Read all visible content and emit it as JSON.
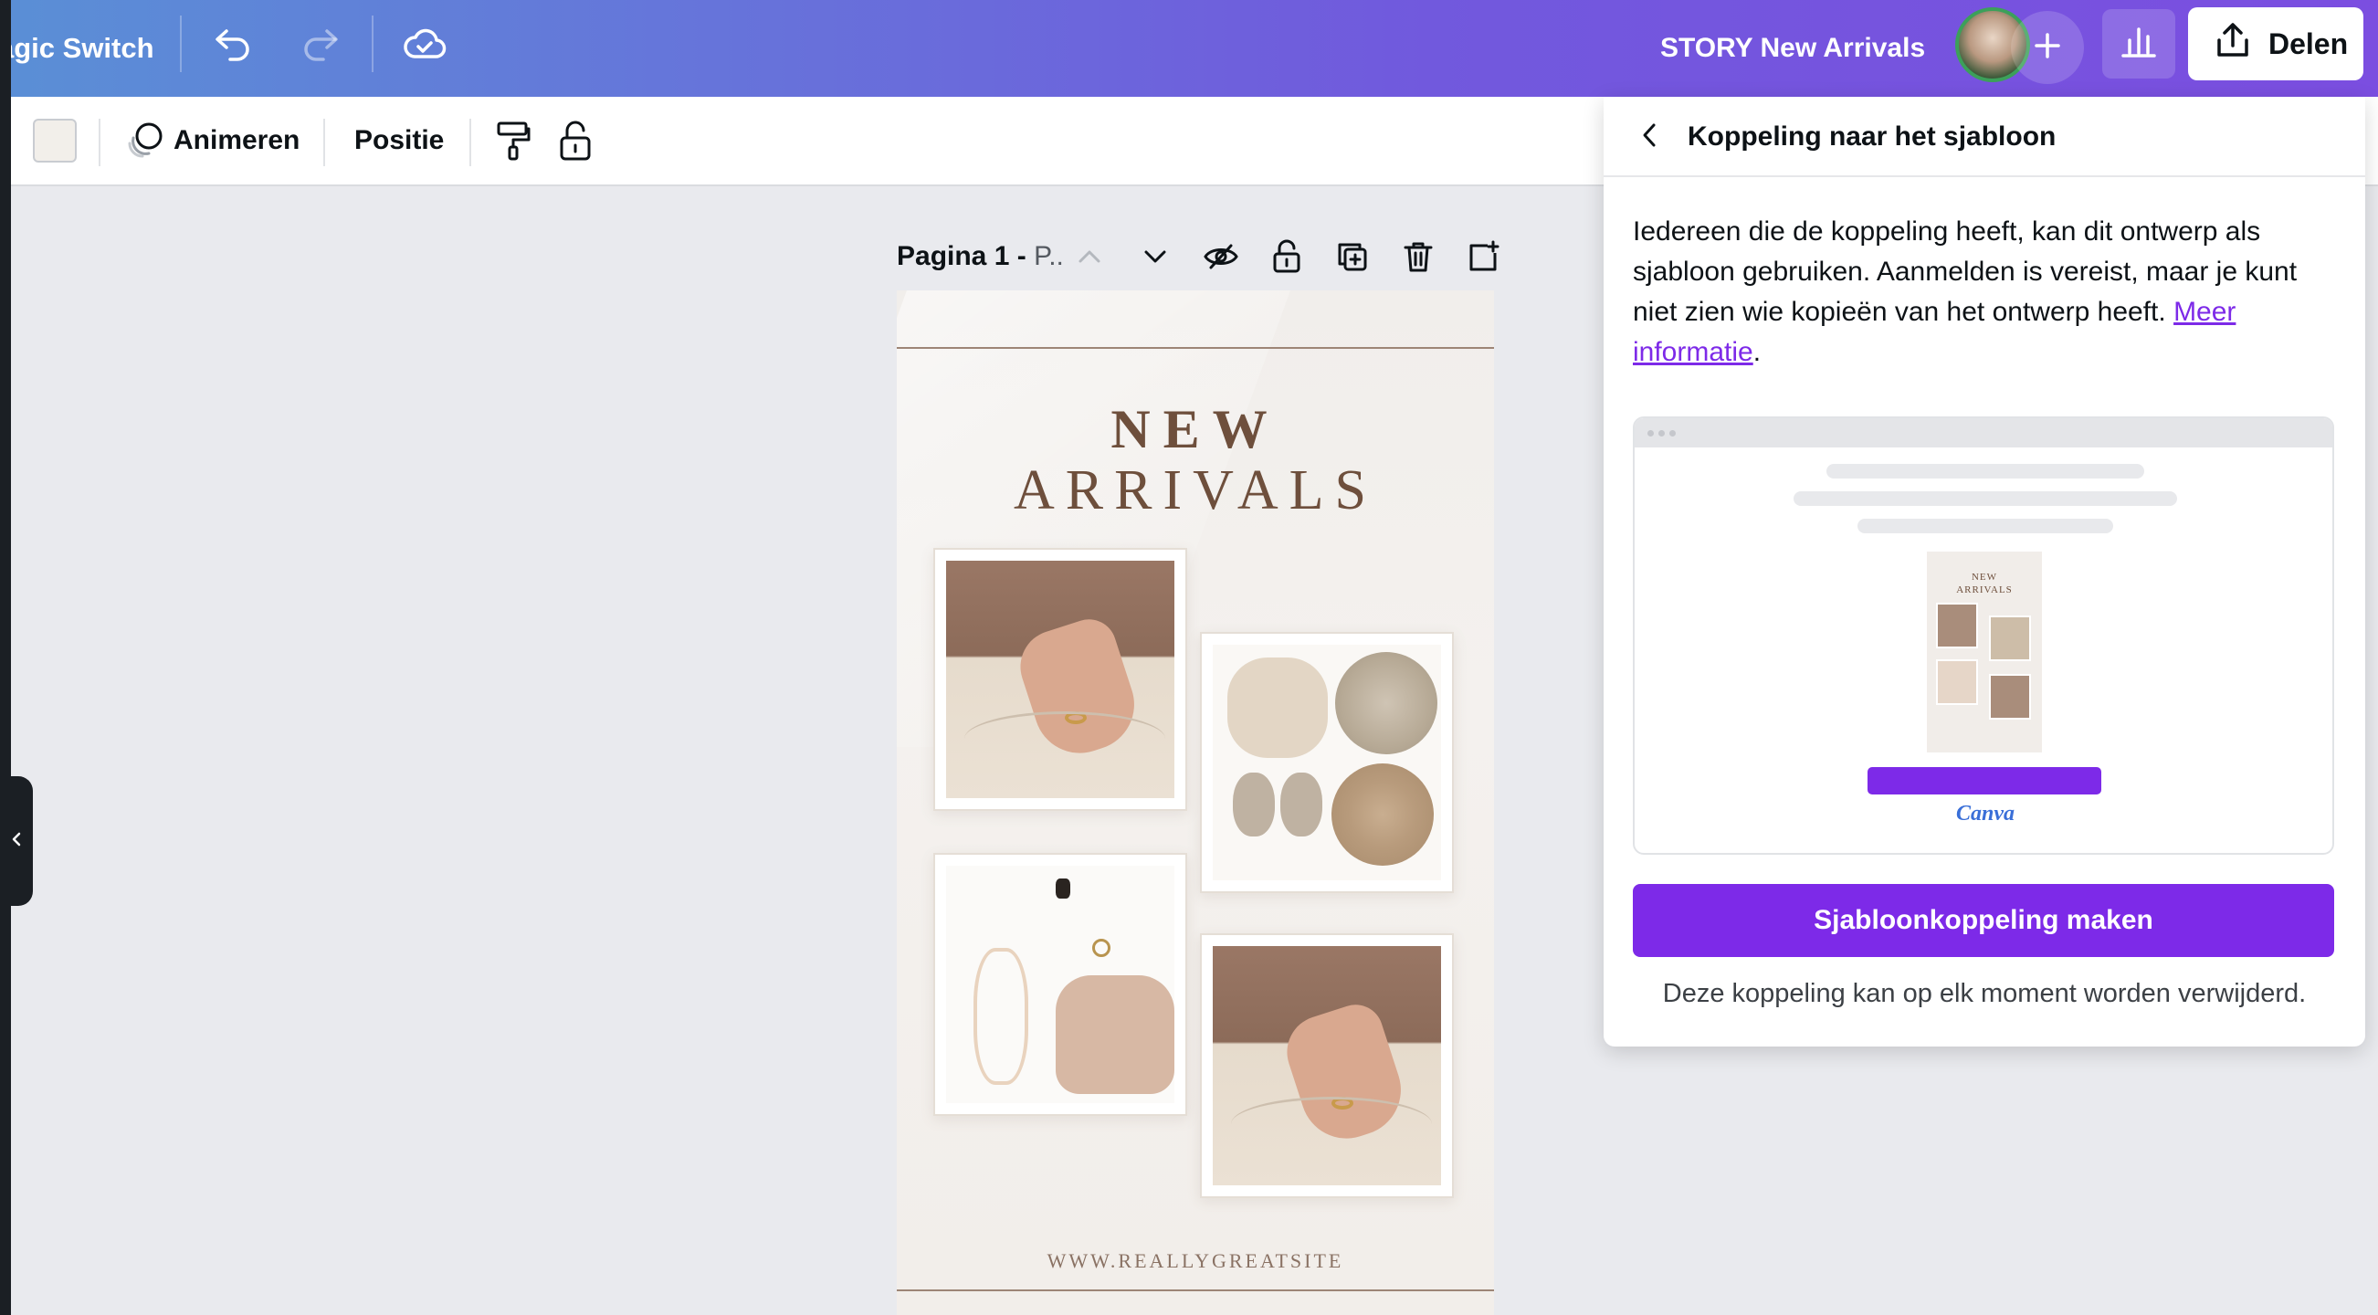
{
  "topbar": {
    "magic_switch_label": "agic Switch",
    "design_title": "STORY New Arrivals",
    "share_label": "Delen",
    "avatar_alt": "avatar",
    "icons": [
      "undo-icon",
      "redo-icon",
      "cloud-sync-icon",
      "plus-icon",
      "bar-chart-icon",
      "upload-icon"
    ]
  },
  "toolbar": {
    "animate_label": "Animeren",
    "position_label": "Positie",
    "swatch_color": "#F2EFEA"
  },
  "page": {
    "title_bold": "Pagina 1 -",
    "title_rest": "P.."
  },
  "design": {
    "title_line_1": "NEW",
    "title_line_2": "ARRIVALS",
    "url": "WWW.REALLYGREATSITE"
  },
  "panel": {
    "title": "Koppeling naar het sjabloon",
    "description": "Iedereen die de koppeling heeft, kan dit ontwerp als sjabloon gebruiken. Aanmelden is vereist, maar je kunt niet zien wie kopieën van het ontwerp heeft.",
    "learn_more": "Meer informatie",
    "learn_more_suffix": ".",
    "preview": {
      "mini_title_1": "NEW",
      "mini_title_2": "ARRIVALS",
      "brand": "Canva"
    },
    "primary_button": "Sjabloonkoppeling maken",
    "footnote": "Deze koppeling kan op elk moment worden verwijderd."
  },
  "colors": {
    "accent": "#7D2AE8",
    "topbar_gradient_start": "#5A8FD6",
    "topbar_gradient_end": "#7B4EE0",
    "design_text": "#6E4F3C"
  }
}
